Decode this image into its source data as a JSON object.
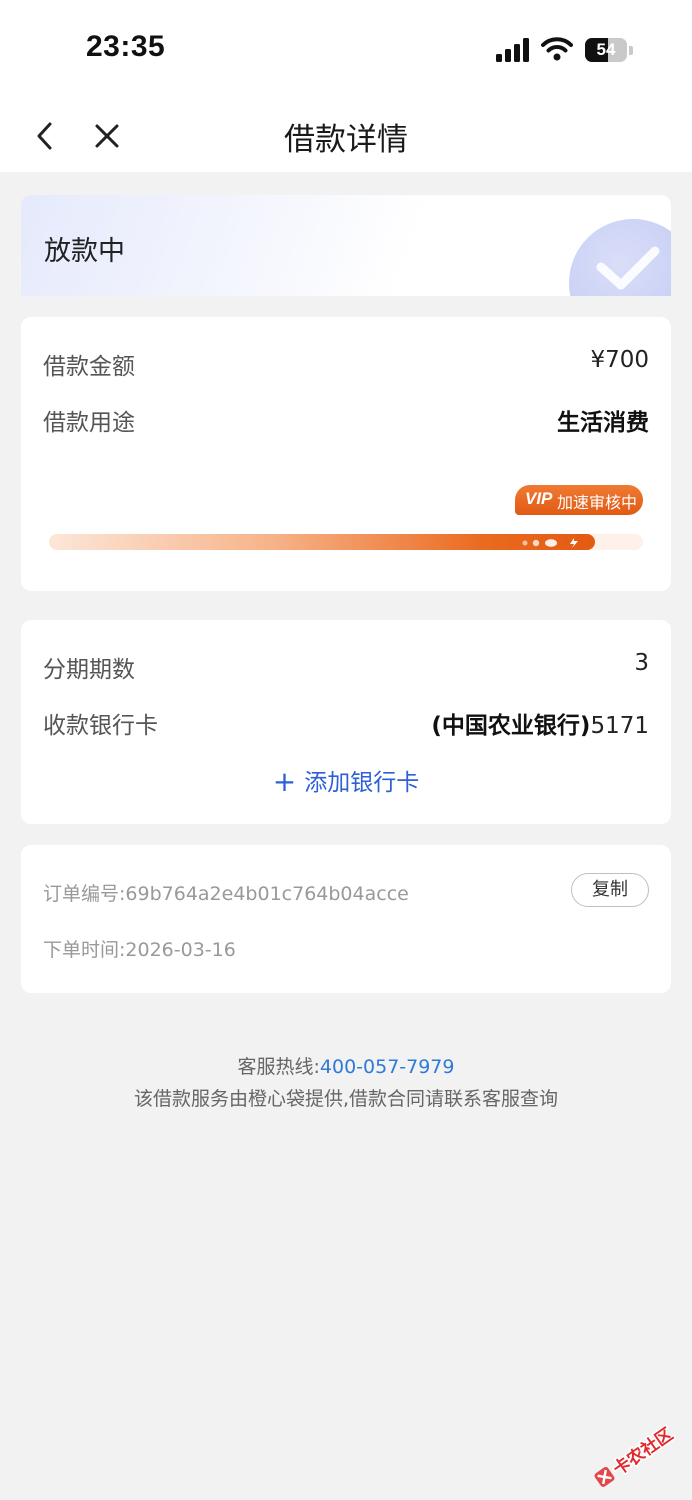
{
  "status_bar": {
    "time": "23:35",
    "battery_level": "54",
    "battery_fraction": 0.54
  },
  "nav": {
    "title": "借款详情"
  },
  "loan_status": {
    "text": "放款中"
  },
  "loan_info": {
    "amount_label": "借款金额",
    "amount_value": "¥700",
    "purpose_label": "借款用途",
    "purpose_value": "生活消费",
    "vip_prefix": "VIP",
    "vip_text": "加速审核中",
    "progress_fraction": 0.92
  },
  "bank_info": {
    "installments_label": "分期期数",
    "installments_value": "3",
    "bank_card_label": "收款银行卡",
    "bank_card_name": "(中国农业银行)",
    "bank_card_number": "5171",
    "add_card_label": "添加银行卡"
  },
  "order_info": {
    "order_no_label": "订单编号:",
    "order_no_value": "69b764a2e4b01c764b04acce",
    "copy_label": "复制",
    "order_time_label": "下单时间:",
    "order_time_value": "2026-03-16"
  },
  "footer": {
    "hotline_label": "客服热线:",
    "hotline_number": "400-057-7979",
    "disclaimer": "该借款服务由橙心袋提供,借款合同请联系客服查询"
  },
  "watermark": {
    "text": "卡农社区"
  },
  "colors": {
    "accent_blue": "#2d5fd6",
    "link_blue": "#2e7ad6",
    "vip_orange": "#e35a12",
    "page_bg": "#f2f2f2"
  },
  "icons": {
    "back": "chevron-left-icon",
    "close": "close-icon",
    "status_check": "check-circle-icon",
    "add": "plus-icon"
  }
}
